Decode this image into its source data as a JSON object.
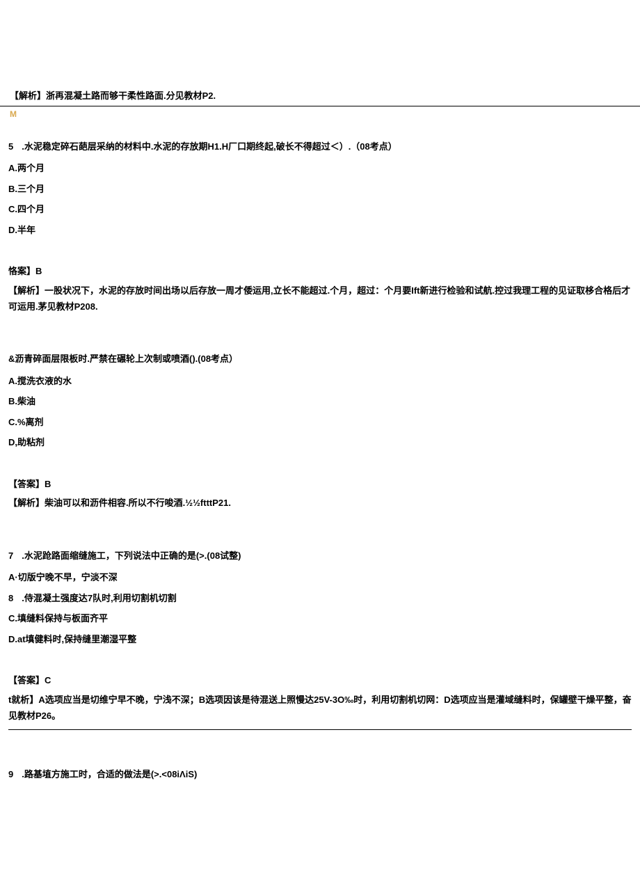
{
  "topAnalysis": "【解析】浙再混凝土路而够干柔性路面.分见教材P2.",
  "mLabel": "M",
  "q5": {
    "num": "5",
    "text": ".水泥稳定碎石葩层采纳的材料中.水泥的存放期H1.H厂口期终起,破长不得超过＜）.（08考点）",
    "optA": "A.两个月",
    "optB": "B.三个月",
    "optC": "C.四个月",
    "optD": "D.半年",
    "answer": "恪案】B",
    "analysis": "【解析】一股状况下，水泥的存放时间出场以后存放一周才倭运用,立长不能超过.个月，超过：个月要Ift新进行检验和试航.控过我理工程的见证取栘合格后才可运用.茅见教材P208."
  },
  "q6": {
    "text": "&沥青碎面层限板时.严禁在碾轮上次制或喷酒().(08考点）",
    "optA": "A.搅洗衣液的水",
    "optB": "B.柴油",
    "optC": "C.%离剂",
    "optD": "D,助粘剂",
    "answer": "【答案】B",
    "analysis": "【解析】柴油可以和沥件相容.所以不行唆酒.½½ftttP21."
  },
  "q7": {
    "num": "7",
    "text": ".水泥跄路面缩缝施工，下列说法中正确的是(>.(08试整)",
    "optA": "A·切版宁晚不早，宁淡不深",
    "optB_num": "8",
    "optB": ".侍混凝土强度达7队时,利用切割机切割",
    "optC": "C.填缝料保持与板面齐平",
    "optD": "D.at填健料时,保持缝里潮湿平整",
    "answer": "【答案】C",
    "analysis": "t就析】A选项应当是切维宁早不晚，宁浅不深；B选项因该是待混送上照慢达25V-3O‰时，利用切割机切网：D选项应当是灌域缝料时，保罐壁干燥平整，奋见教材P26。"
  },
  "q9": {
    "num": "9",
    "text": ".路基埴方施工时，合适的做法是(>.<08iΛiS)"
  }
}
